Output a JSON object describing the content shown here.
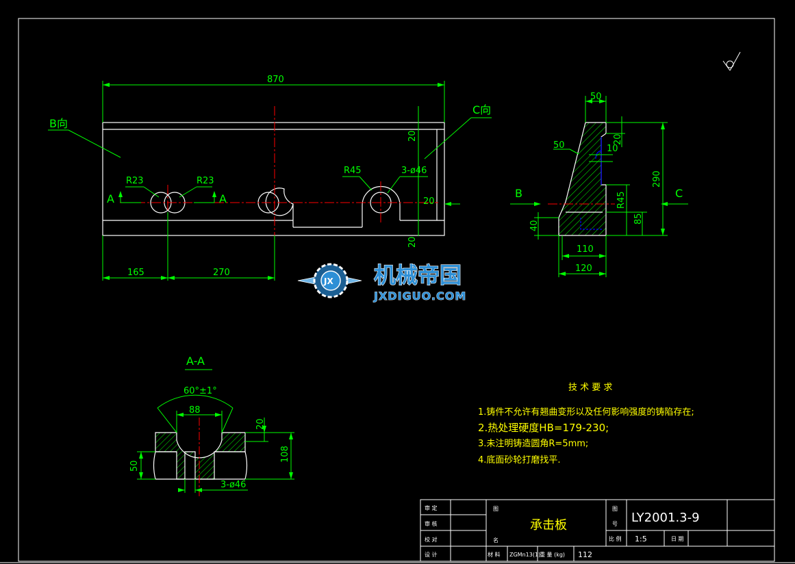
{
  "views": {
    "front": {
      "dim_length": "870",
      "dim_left": "165",
      "dim_mid": "270",
      "dim_20_top": "20",
      "dim_20_mid": "20",
      "dim_20_bot": "20",
      "r23_left": "R23",
      "r23_right": "R23",
      "r45": "R45",
      "holes": "3-ø46",
      "label_b": "B向",
      "label_c": "C向",
      "section_a_left": "A",
      "section_a_right": "A"
    },
    "side": {
      "dim_top": "50",
      "dim_chamfer": "50",
      "dim_10": "10",
      "dim_20": "20",
      "dim_290": "290",
      "dim_r45": "R45",
      "dim_85": "85",
      "dim_40": "40",
      "dim_110": "110",
      "dim_120": "120",
      "arrow_b": "B",
      "arrow_c": "C"
    },
    "section": {
      "title": "A-A",
      "angle": "60°±1°",
      "dim_88": "88",
      "dim_20": "20",
      "dim_108": "108",
      "dim_50": "50",
      "holes": "3-ø46"
    }
  },
  "watermark": {
    "badge": "JX",
    "name": "机械帝国",
    "url": "JXDIGUO.COM"
  },
  "requirements": {
    "title": "技 术 要 求",
    "items": [
      "1.铸件不允许有翘曲变形以及任何影响强度的铸陷存在;",
      "2.热处理硬度HB=179-230;",
      "3.未注明铸造圆角R=5mm;",
      "4.底面砂轮打磨找平."
    ]
  },
  "title_block": {
    "rows_left": [
      "审 定",
      "审 核",
      "校 对",
      "设 计"
    ],
    "tu": "图",
    "ming": "名",
    "part_name": "承击板",
    "tu2": "图",
    "hao": "号",
    "drawing_no": "LY2001.3-9",
    "scale_label": "比 例",
    "scale": "1:5",
    "date_label": "日 期",
    "material_label": "材 料",
    "material": "ZGMn13(1)",
    "weight_label": "重 量 (kg)",
    "weight": "112"
  },
  "colors": {
    "outline": "#ffffff",
    "dimension": "#00ff00",
    "centerline": "#ff0000",
    "hidden": "#0000ff",
    "hatch": "#00ff00",
    "requirements": "#ffff00"
  }
}
